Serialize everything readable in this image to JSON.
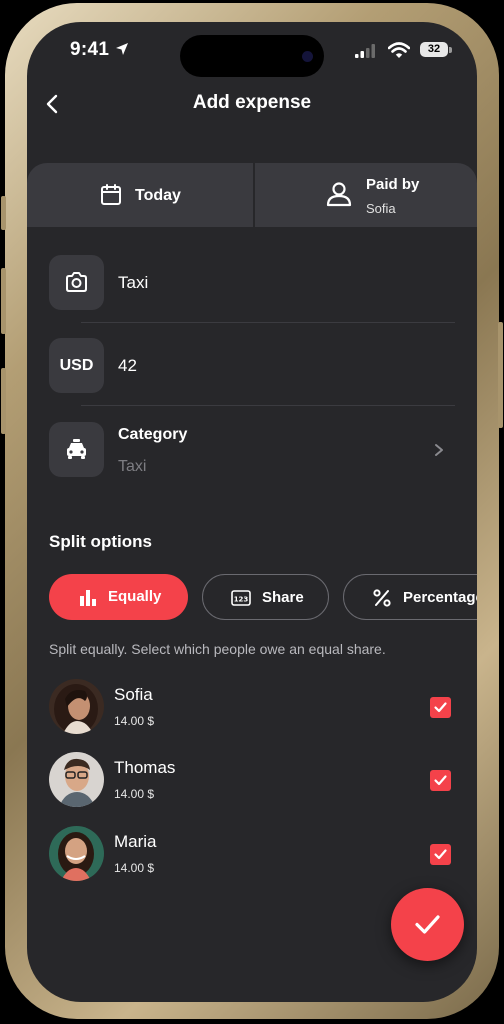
{
  "status_bar": {
    "time": "9:41",
    "battery": "32"
  },
  "header": {
    "title": "Add expense"
  },
  "top_cards": {
    "date_label": "Today",
    "paid_by_label": "Paid by",
    "paid_by_name": "Sofia"
  },
  "form": {
    "description": "Taxi",
    "currency": "USD",
    "amount": "42",
    "category_label": "Category",
    "category_value": "Taxi"
  },
  "split": {
    "title": "Split options",
    "options": [
      {
        "label": "Equally",
        "selected": true
      },
      {
        "label": "Share",
        "selected": false
      },
      {
        "label": "Percentage",
        "selected": false
      }
    ],
    "description": "Split equally. Select which people owe an equal share."
  },
  "people": [
    {
      "name": "Sofia",
      "amount": "14.00 $",
      "checked": true
    },
    {
      "name": "Thomas",
      "amount": "14.00 $",
      "checked": true
    },
    {
      "name": "Maria",
      "amount": "14.00 $",
      "checked": true
    }
  ],
  "colors": {
    "accent": "#f4424a",
    "background": "#27272a",
    "card": "#3a3a3f"
  },
  "icons": {
    "back": "chevron-left-icon",
    "date": "calendar-icon",
    "paid_by": "user-icon",
    "description": "camera-icon",
    "category": "taxi-icon",
    "equally": "bar-chart-icon",
    "share": "123-icon",
    "percentage": "percent-icon",
    "confirm": "check-icon"
  }
}
